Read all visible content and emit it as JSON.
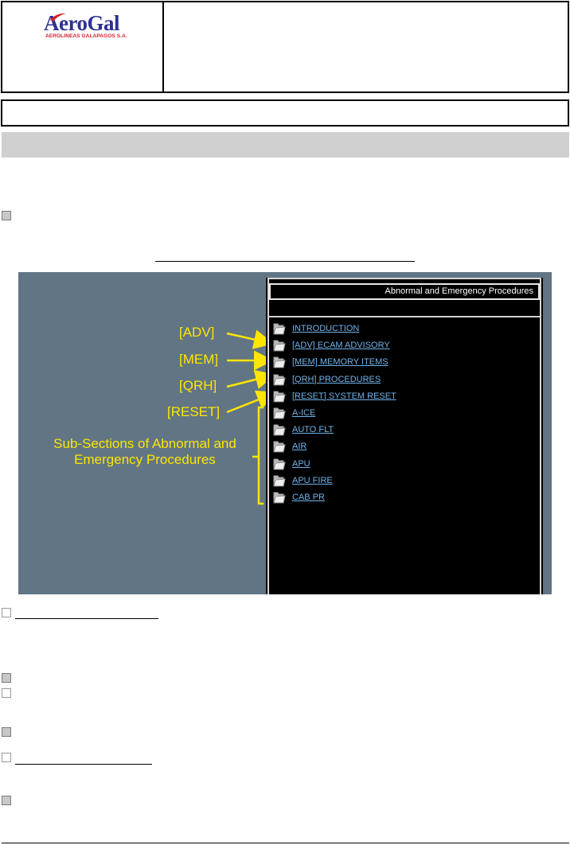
{
  "header": {
    "logo_name": "AeroGal",
    "logo_tagline": "AEROLINEAS GALAPAGOS S.A."
  },
  "figure": {
    "screen_title": "Abnormal and Emergency Procedures",
    "menu_items": [
      {
        "label": "INTRODUCTION"
      },
      {
        "label": "[ADV] ECAM ADVISORY"
      },
      {
        "label": "[MEM] MEMORY ITEMS"
      },
      {
        "label": "[QRH] PROCEDURES"
      },
      {
        "label": "[RESET] SYSTEM RESET"
      },
      {
        "label": "A-ICE"
      },
      {
        "label": "AUTO FLT"
      },
      {
        "label": "AIR"
      },
      {
        "label": "APU"
      },
      {
        "label": "APU FIRE"
      },
      {
        "label": "CAB PR"
      }
    ],
    "callouts": {
      "adv": "[ADV]",
      "mem": "[MEM]",
      "qrh": "[QRH]",
      "reset": "[RESET]",
      "subsections": "Sub-Sections of Abnormal and Emergency Procedures"
    }
  },
  "colors": {
    "figure_background": "#617585",
    "screen_background": "#000000",
    "link": "#6fb3ea",
    "callout": "#ffe600",
    "grey_band": "#d0d0d0"
  },
  "icons": {
    "folder": "folder-icon",
    "checkbox": "checkbox-icon",
    "logo_mark": "aerogal-swoosh-icon"
  }
}
